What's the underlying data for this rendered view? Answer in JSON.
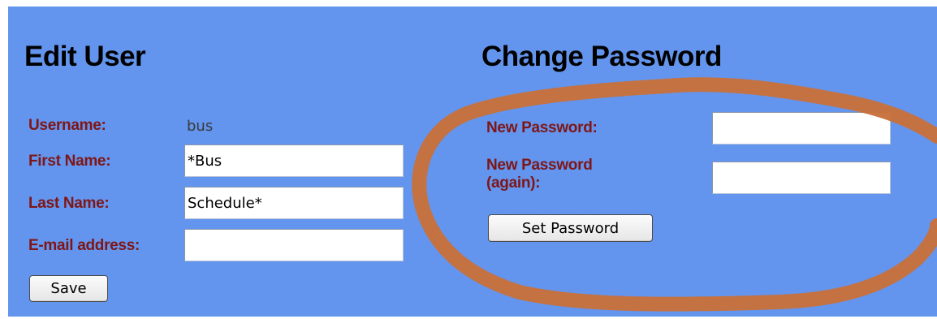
{
  "edit_user": {
    "title": "Edit User",
    "username_label": "Username:",
    "username_value": "bus",
    "first_name_label": "First Name:",
    "first_name_value": "*Bus",
    "last_name_label": "Last Name:",
    "last_name_value": "Schedule*",
    "email_label": "E-mail address:",
    "email_value": "",
    "save_label": "Save"
  },
  "change_password": {
    "title": "Change Password",
    "new_password_label": "New Password:",
    "new_password_again_label_line1": "New Password",
    "new_password_again_label_line2": "(again):",
    "new_password_value": "",
    "new_password_again_value": "",
    "set_password_label": "Set Password"
  },
  "colors": {
    "panel_background": "#6395ee",
    "label_text": "#7f1616",
    "annotation_ring": "#c8703a"
  }
}
